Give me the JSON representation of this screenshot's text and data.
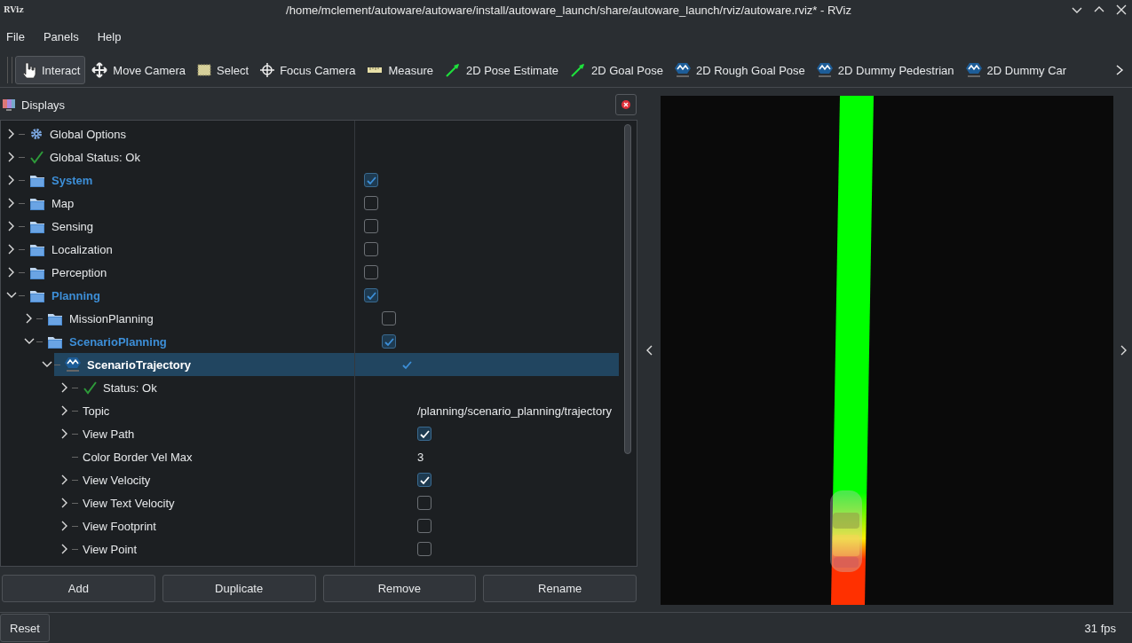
{
  "window": {
    "logo": "RViz",
    "title": "/home/mclement/autoware/autoware/install/autoware_launch/share/autoware_launch/rviz/autoware.rviz* - RViz"
  },
  "menu": [
    "File",
    "Panels",
    "Help"
  ],
  "tools": [
    {
      "label": "Interact",
      "kind": "interact",
      "selected": true
    },
    {
      "label": "Move Camera",
      "kind": "move",
      "selected": false
    },
    {
      "label": "Select",
      "kind": "select",
      "selected": false
    },
    {
      "label": "Focus Camera",
      "kind": "focus",
      "selected": false
    },
    {
      "label": "Measure",
      "kind": "measure",
      "selected": false
    },
    {
      "label": "2D Pose Estimate",
      "kind": "arrow",
      "selected": false
    },
    {
      "label": "2D Goal Pose",
      "kind": "arrow",
      "selected": false
    },
    {
      "label": "2D Rough Goal Pose",
      "kind": "plugin",
      "selected": false
    },
    {
      "label": "2D Dummy Pedestrian",
      "kind": "plugin",
      "selected": false
    },
    {
      "label": "2D Dummy Car",
      "kind": "plugin",
      "selected": false
    }
  ],
  "displays": {
    "title": "Displays",
    "tree": [
      {
        "label": "Global Options",
        "kind": "gear",
        "expanded": false
      },
      {
        "label": "Global Status: Ok",
        "kind": "status",
        "expanded": false
      },
      {
        "label": "System",
        "kind": "folder",
        "expanded": false,
        "checked": true
      },
      {
        "label": "Map",
        "kind": "folder",
        "expanded": false,
        "checked": false
      },
      {
        "label": "Sensing",
        "kind": "folder",
        "expanded": false,
        "checked": false
      },
      {
        "label": "Localization",
        "kind": "folder",
        "expanded": false,
        "checked": false
      },
      {
        "label": "Perception",
        "kind": "folder",
        "expanded": false,
        "checked": false
      },
      {
        "label": "Planning",
        "kind": "folder",
        "expanded": true,
        "checked": true,
        "children": [
          {
            "label": "MissionPlanning",
            "kind": "folder",
            "expanded": false,
            "checked": false
          },
          {
            "label": "ScenarioPlanning",
            "kind": "folder",
            "expanded": true,
            "checked": true,
            "children": [
              {
                "label": "ScenarioTrajectory",
                "kind": "plugin",
                "expanded": true,
                "checked": true,
                "selected": true,
                "children": [
                  {
                    "label": "Status: Ok",
                    "kind": "status",
                    "expanded": false
                  },
                  {
                    "label": "Topic",
                    "kind": "property",
                    "expanded": false,
                    "value": "/planning/scenario_planning/trajectory"
                  },
                  {
                    "label": "View Path",
                    "kind": "property",
                    "expanded": false,
                    "checked": true
                  },
                  {
                    "label": "Color Border Vel Max",
                    "kind": "property",
                    "value": "3"
                  },
                  {
                    "label": "View Velocity",
                    "kind": "property",
                    "expanded": false,
                    "checked": true
                  },
                  {
                    "label": "View Text Velocity",
                    "kind": "property",
                    "expanded": false,
                    "checked": false
                  },
                  {
                    "label": "View Footprint",
                    "kind": "property",
                    "expanded": false,
                    "checked": false
                  },
                  {
                    "label": "View Point",
                    "kind": "property",
                    "expanded": false,
                    "checked": false
                  }
                ]
              }
            ]
          }
        ]
      }
    ],
    "buttons": [
      "Add",
      "Duplicate",
      "Remove",
      "Rename"
    ]
  },
  "status_bar": {
    "button": "Reset",
    "fps": "31 fps"
  }
}
